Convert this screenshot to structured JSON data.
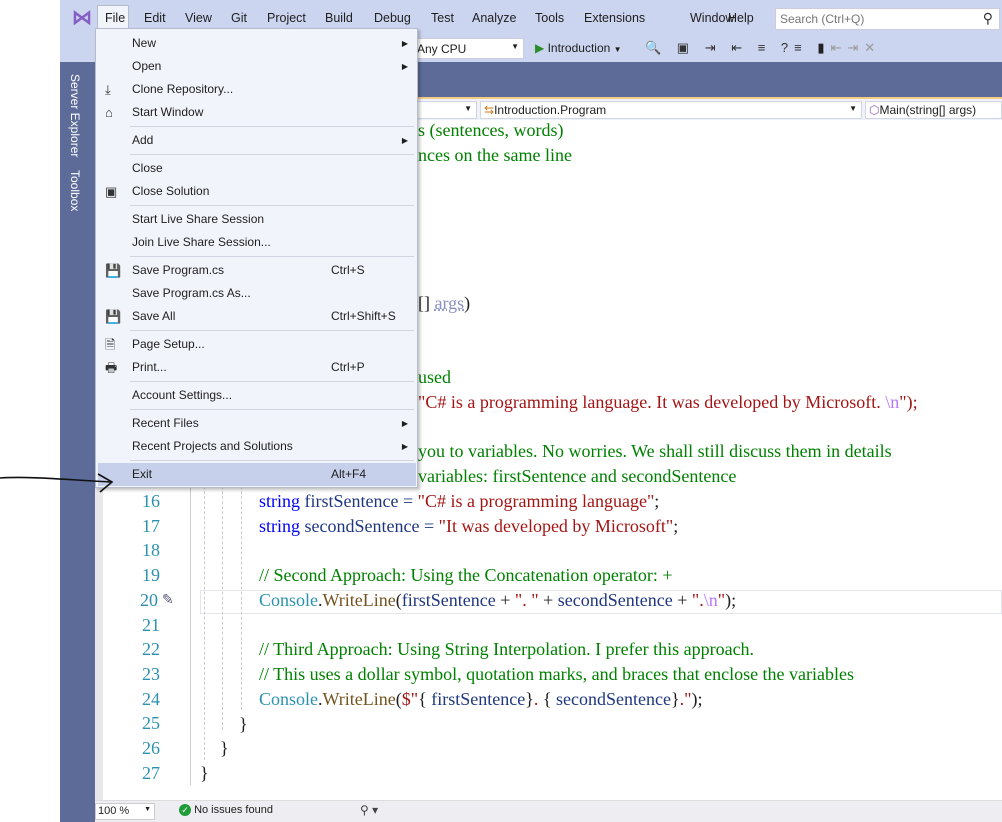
{
  "menubar": {
    "items": [
      "File",
      "Edit",
      "View",
      "Git",
      "Project",
      "Build",
      "Debug",
      "Test",
      "Analyze",
      "Tools",
      "Extensions",
      "Window",
      "Help"
    ],
    "search_placeholder": "Search (Ctrl+Q)"
  },
  "toolbar": {
    "platform": "Any CPU",
    "start": "Introduction"
  },
  "sidetabs": [
    "Server Explorer",
    "Toolbox"
  ],
  "navbar": {
    "class": "Introduction.Program",
    "member": "Main(string[] args)"
  },
  "file_menu": [
    {
      "label": "New",
      "submenu": true
    },
    {
      "label": "Open",
      "submenu": true
    },
    {
      "label": "Clone Repository...",
      "icon": "clone-icon"
    },
    {
      "label": "Start Window",
      "icon": "start-window-icon"
    },
    {
      "sep": true
    },
    {
      "label": "Add",
      "submenu": true
    },
    {
      "sep": true
    },
    {
      "label": "Close"
    },
    {
      "label": "Close Solution",
      "icon": "close-solution-icon"
    },
    {
      "sep": true
    },
    {
      "label": "Start Live Share Session"
    },
    {
      "label": "Join Live Share Session..."
    },
    {
      "sep": true
    },
    {
      "label": "Save Program.cs",
      "shortcut": "Ctrl+S",
      "icon": "save-icon"
    },
    {
      "label": "Save Program.cs As..."
    },
    {
      "label": "Save All",
      "shortcut": "Ctrl+Shift+S",
      "icon": "save-all-icon"
    },
    {
      "sep": true
    },
    {
      "label": "Page Setup...",
      "icon": "page-setup-icon"
    },
    {
      "label": "Print...",
      "shortcut": "Ctrl+P",
      "icon": "print-icon"
    },
    {
      "sep": true
    },
    {
      "label": "Account Settings..."
    },
    {
      "sep": true
    },
    {
      "label": "Recent Files",
      "submenu": true
    },
    {
      "label": "Recent Projects and Solutions",
      "submenu": true
    },
    {
      "sep": true
    },
    {
      "label": "Exit",
      "shortcut": "Alt+F4",
      "highlighted": true
    }
  ],
  "code": {
    "l1": "s (sentences, words)",
    "l2": "nces on the same line",
    "l8a": "[] ",
    "l8b": "args",
    "l8c": ")",
    "l11": "used",
    "l12a": "\"C# is a programming language. It was developed by Microsoft. ",
    "l12b": "\\n",
    "l12c": "\");",
    "l14": "you to variables. No worries. We shall still discuss them in details",
    "l15": "variables: firstSentence and secondSentence",
    "l16": [
      "string",
      " firstSentence = ",
      "\"C# is a programming language\"",
      ";"
    ],
    "l17": [
      "string",
      " secondSentence = ",
      "\"It was developed by Microsoft\"",
      ";"
    ],
    "l19": "// Second Approach: Using the Concatenation operator: +",
    "l20": [
      "Console",
      ".",
      "WriteLine",
      "(",
      "firstSentence",
      " + ",
      "\". \"",
      " + ",
      "secondSentence",
      " + ",
      "\".",
      "\\n",
      "\"",
      ");"
    ],
    "l22": "// Third Approach: Using String Interpolation. I prefer this approach.",
    "l23": "// This uses a dollar symbol, quotation marks, and braces that enclose the variables",
    "l24": [
      "Console",
      ".",
      "WriteLine",
      "(",
      "$\"",
      "{ ",
      "firstSentence",
      "}",
      ". ",
      "{ ",
      "secondSentence",
      "}",
      ".\"",
      ");"
    ],
    "l25": "}",
    "l26": "}",
    "l27": "}"
  },
  "line_numbers": [
    "16",
    "17",
    "18",
    "19",
    "20",
    "21",
    "22",
    "23",
    "24",
    "25",
    "26",
    "27"
  ],
  "status": {
    "zoom": "100 %",
    "issues": "No issues found"
  }
}
